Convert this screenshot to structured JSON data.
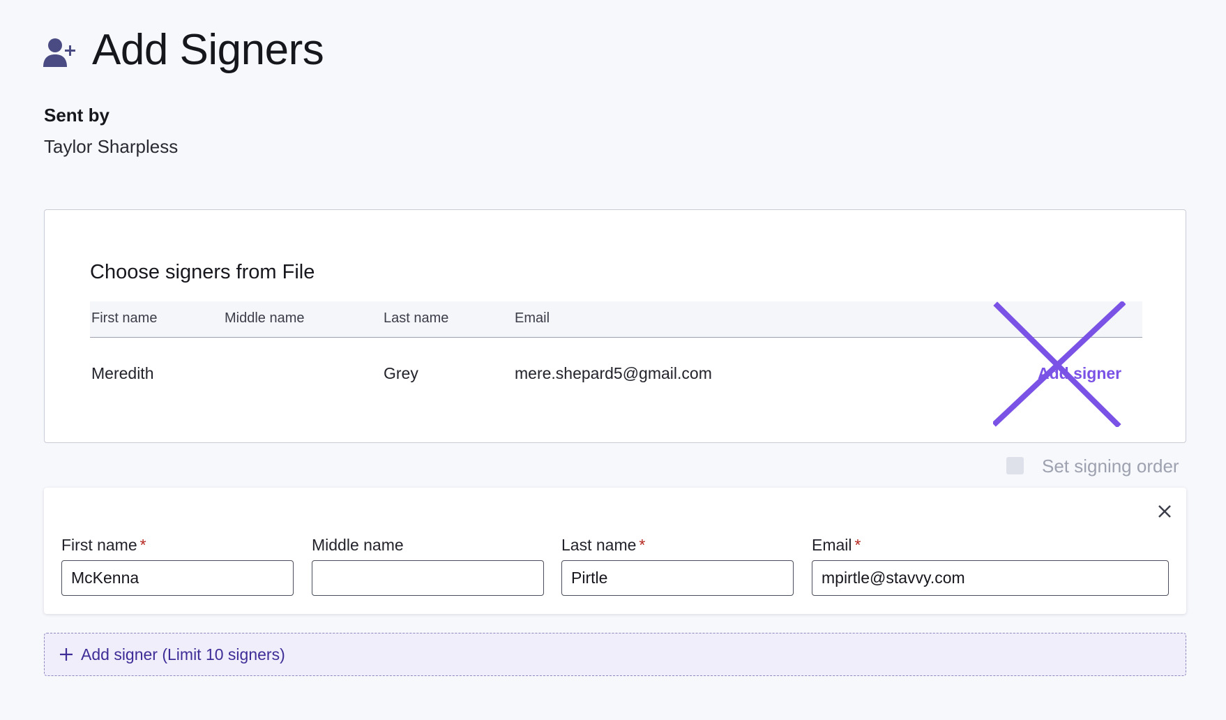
{
  "header": {
    "title": "Add Signers",
    "icon": "user-plus-icon",
    "icon_color": "#4a4b82"
  },
  "sent_by": {
    "label": "Sent by",
    "name": "Taylor Sharpless"
  },
  "file_signers": {
    "title": "Choose signers from File",
    "columns": [
      "First name",
      "Middle name",
      "Last name",
      "Email"
    ],
    "rows": [
      {
        "first_name": "Meredith",
        "middle_name": "",
        "last_name": "Grey",
        "email": "mere.shepard5@gmail.com",
        "action_label": "Add signer"
      }
    ]
  },
  "signing_order": {
    "label": "Set signing order",
    "checked": false
  },
  "signer_form": {
    "fields": [
      {
        "label": "First name",
        "required": true,
        "value": "McKenna"
      },
      {
        "label": "Middle name",
        "required": false,
        "value": ""
      },
      {
        "label": "Last name",
        "required": true,
        "value": "Pirtle"
      },
      {
        "label": "Email",
        "required": true,
        "value": "mpirtle@stavvy.com"
      }
    ],
    "required_marker": "*"
  },
  "add_signer_bar": {
    "label": "Add signer (Limit 10 signers)"
  },
  "colors": {
    "accent_purple": "#7b52e6",
    "add_bar_text": "#3f2d97",
    "required_red": "#b5271f",
    "muted_text": "#9ea2b0"
  }
}
